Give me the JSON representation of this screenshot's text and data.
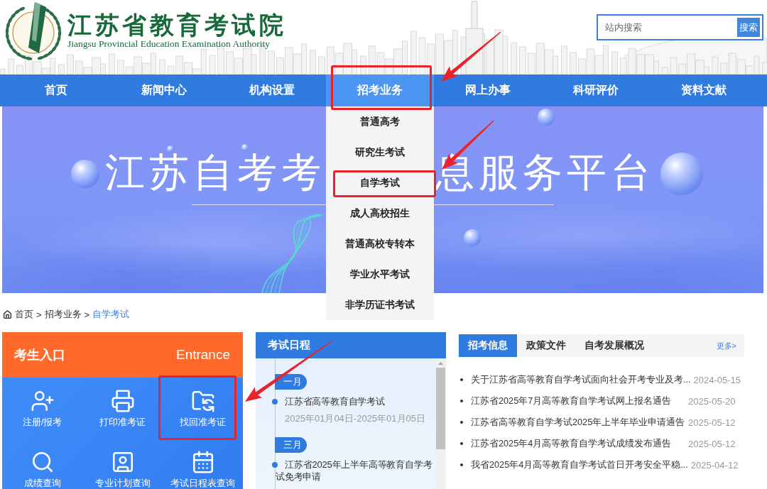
{
  "header": {
    "title": "江苏省教育考试院",
    "subtitle": "Jiangsu Provincial Education Examination Authority",
    "search": {
      "placeholder": "站内搜索",
      "button": "搜索"
    }
  },
  "nav": {
    "items": [
      {
        "label": "首页",
        "selected": false,
        "highlighted": false
      },
      {
        "label": "新闻中心",
        "selected": false,
        "highlighted": false
      },
      {
        "label": "机构设置",
        "selected": false,
        "highlighted": false
      },
      {
        "label": "招考业务",
        "selected": true,
        "highlighted": true,
        "menu": [
          {
            "label": "普通高考",
            "highlighted": false
          },
          {
            "label": "研究生考试",
            "highlighted": false
          },
          {
            "label": "自学考试",
            "highlighted": true
          },
          {
            "label": "成人高校招生",
            "highlighted": false
          },
          {
            "label": "普通高校专转本",
            "highlighted": false
          },
          {
            "label": "学业水平考试",
            "highlighted": false
          },
          {
            "label": "非学历证书考试",
            "highlighted": false
          }
        ]
      },
      {
        "label": "网上办事",
        "selected": false,
        "highlighted": false
      },
      {
        "label": "科研评价",
        "selected": false,
        "highlighted": false
      },
      {
        "label": "资料文献",
        "selected": false,
        "highlighted": false
      }
    ]
  },
  "banner": {
    "title_parts": [
      "江苏自考考",
      "息服务平台"
    ]
  },
  "breadcrumb": [
    {
      "kind": "link",
      "label": "首页"
    },
    {
      "kind": "separator",
      "label": ">"
    },
    {
      "kind": "link",
      "label": "招考业务"
    },
    {
      "kind": "separator",
      "label": ">"
    },
    {
      "kind": "current",
      "label": "自学考试"
    }
  ],
  "entrance": {
    "title": "考生入口",
    "title_en": "Entrance",
    "items": [
      {
        "label": "注册/报考",
        "highlighted": false
      },
      {
        "label": "打印准考证",
        "highlighted": false
      },
      {
        "label": "找回准考证",
        "highlighted": true
      },
      {
        "label": "成绩查询",
        "highlighted": false
      },
      {
        "label": "专业计划查询",
        "highlighted": false
      },
      {
        "label": "考试日程表查询",
        "highlighted": false
      }
    ]
  },
  "schedule": {
    "title": "考试日程",
    "months": [
      {
        "label": "一月",
        "events": [
          {
            "title": "江苏省高等教育自学考试",
            "dates": "2025年01月04日-2025年01月05日"
          }
        ]
      },
      {
        "label": "三月",
        "events": [
          {
            "title": "江苏省2025年上半年高等教育自学考试免考申请"
          }
        ]
      }
    ]
  },
  "news": {
    "tabs": [
      {
        "label": "招考信息",
        "selected": true
      },
      {
        "label": "政策文件",
        "selected": false
      },
      {
        "label": "自考发展概况",
        "selected": false
      }
    ],
    "more": "更多>",
    "rows": [
      {
        "title": "关于江苏省高等教育自学考试面向社会开考专业及考...",
        "date": "2024-05-15"
      },
      {
        "title": "江苏省2025年7月高等教育自学考试网上报名通告",
        "date": "2025-05-20"
      },
      {
        "title": "江苏省高等教育自学考试2025年上半年毕业申请通告",
        "date": "2025-05-12"
      },
      {
        "title": "江苏省2025年4月高等教育自学考试成绩发布通告",
        "date": "2025-05-12"
      },
      {
        "title": "我省2025年4月高等教育自学考试首日开考安全平稳...",
        "date": "2025-04-12"
      }
    ]
  }
}
